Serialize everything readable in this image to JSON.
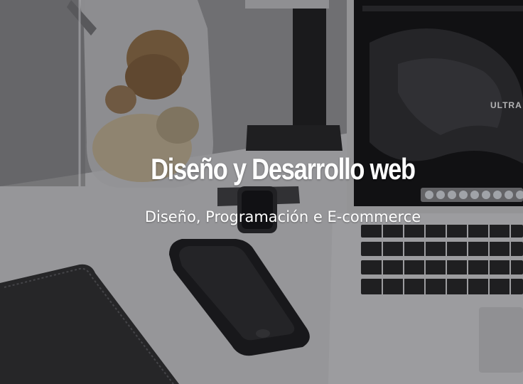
{
  "hero": {
    "title": "Diseño y Desarrollo web",
    "subtitle": "Diseño, Programación e E-commerce"
  },
  "laptop_screen": {
    "word": "ULTRA"
  },
  "colors": {
    "title_text": "#ffffff",
    "overlay": "#141418",
    "desk": "#d4d4d6",
    "notebook": "#2e2e30",
    "phone": "#1b1b1d"
  },
  "icons": [
    "cookie-jar",
    "smartwatch",
    "smartphone",
    "laptop",
    "monitor-stand",
    "notebook"
  ]
}
